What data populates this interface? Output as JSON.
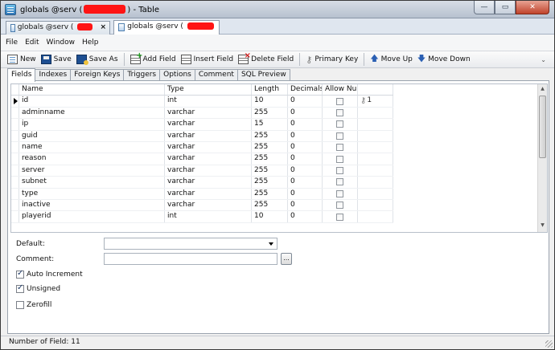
{
  "window": {
    "title_prefix": "globals @serv (",
    "title_suffix": ") - Table",
    "minimize_glyph": "—",
    "maximize_glyph": "▭",
    "close_glyph": "✕"
  },
  "doc_tabs": [
    {
      "label": "globals @serv (",
      "close": "×"
    },
    {
      "label": "globals @serv ("
    }
  ],
  "menu": [
    "File",
    "Edit",
    "Window",
    "Help"
  ],
  "toolbar": {
    "new": "New",
    "save": "Save",
    "save_as": "Save As",
    "add_field": "Add Field",
    "insert_field": "Insert Field",
    "delete_field": "Delete Field",
    "primary_key": "Primary Key",
    "move_up": "Move Up",
    "move_down": "Move Down"
  },
  "section_tabs": [
    "Fields",
    "Indexes",
    "Foreign Keys",
    "Triggers",
    "Options",
    "Comment",
    "SQL Preview"
  ],
  "grid": {
    "columns": [
      "Name",
      "Type",
      "Length",
      "Decimals",
      "Allow Null"
    ],
    "rows": [
      {
        "name": "id",
        "type": "int",
        "length": "10",
        "decimals": "0",
        "pk": "1"
      },
      {
        "name": "adminname",
        "type": "varchar",
        "length": "255",
        "decimals": "0",
        "pk": ""
      },
      {
        "name": "ip",
        "type": "varchar",
        "length": "15",
        "decimals": "0",
        "pk": ""
      },
      {
        "name": "guid",
        "type": "varchar",
        "length": "255",
        "decimals": "0",
        "pk": ""
      },
      {
        "name": "name",
        "type": "varchar",
        "length": "255",
        "decimals": "0",
        "pk": ""
      },
      {
        "name": "reason",
        "type": "varchar",
        "length": "255",
        "decimals": "0",
        "pk": ""
      },
      {
        "name": "server",
        "type": "varchar",
        "length": "255",
        "decimals": "0",
        "pk": ""
      },
      {
        "name": "subnet",
        "type": "varchar",
        "length": "255",
        "decimals": "0",
        "pk": ""
      },
      {
        "name": "type",
        "type": "varchar",
        "length": "255",
        "decimals": "0",
        "pk": ""
      },
      {
        "name": "inactive",
        "type": "varchar",
        "length": "255",
        "decimals": "0",
        "pk": ""
      },
      {
        "name": "playerid",
        "type": "int",
        "length": "10",
        "decimals": "0",
        "pk": ""
      }
    ]
  },
  "properties": {
    "default_label": "Default:",
    "comment_label": "Comment:",
    "comment_button": "...",
    "auto_increment": {
      "label": "Auto Increment",
      "checked": true
    },
    "unsigned": {
      "label": "Unsigned",
      "checked": true
    },
    "zerofill": {
      "label": "Zerofill",
      "checked": false
    }
  },
  "status": "Number of Field: 11",
  "colors": {
    "redaction": "#ff1414",
    "title_gradient_top": "#d7dde6"
  },
  "icons": [
    "app-table-icon",
    "new-table-icon",
    "save-icon",
    "save-as-icon",
    "add-field-icon",
    "insert-field-icon",
    "delete-field-icon",
    "key-icon",
    "arrow-up-icon",
    "arrow-down-icon"
  ]
}
